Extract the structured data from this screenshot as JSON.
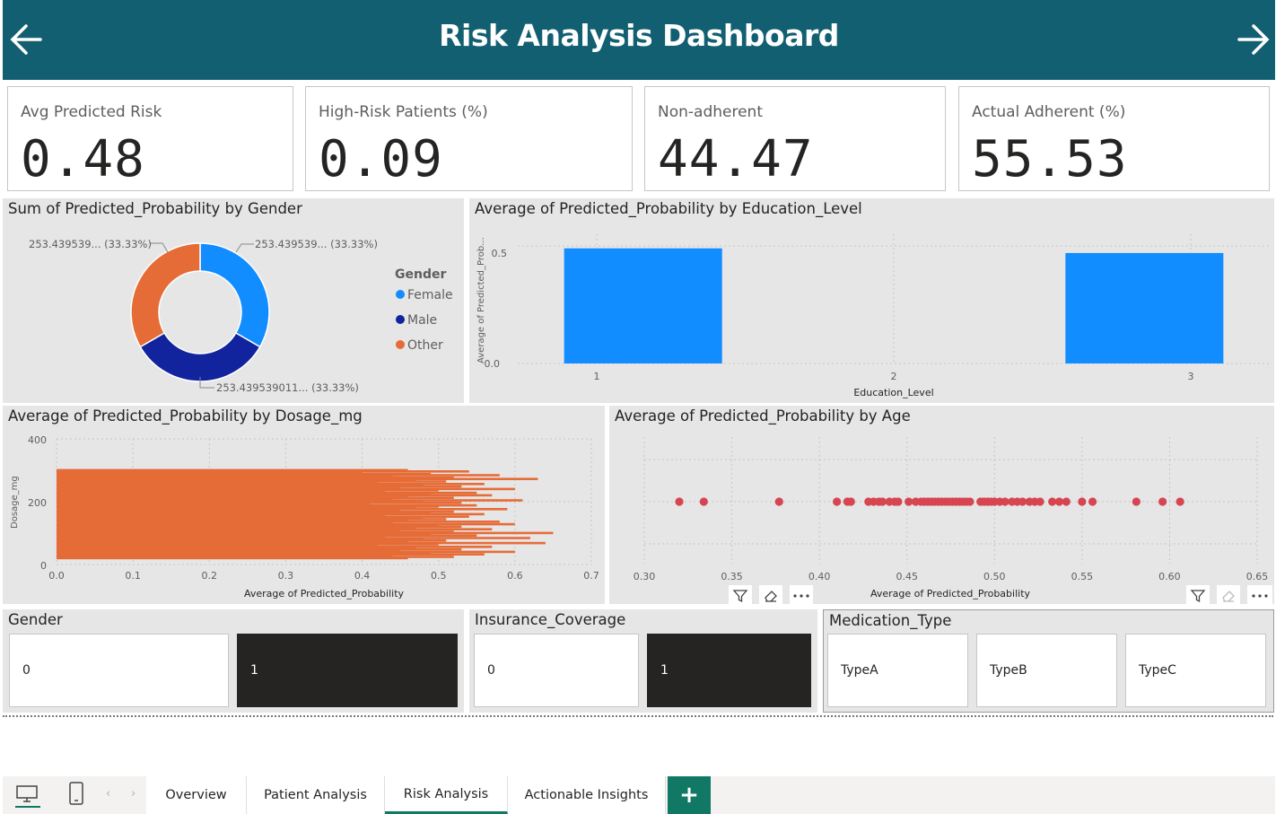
{
  "header": {
    "title": "Risk Analysis Dashboard"
  },
  "kpis": [
    {
      "label": "Avg Predicted Risk",
      "value": "0.48"
    },
    {
      "label": "High-Risk Patients (%)",
      "value": "0.09"
    },
    {
      "label": "Non-adherent",
      "value": "44.47"
    },
    {
      "label": "Actual Adherent (%)",
      "value": "55.53"
    }
  ],
  "donut": {
    "title": "Sum of Predicted_Probability by Gender",
    "labels": [
      "253.439539... (33.33%)",
      "253.439539... (33.33%)",
      "253.439539011... (33.33%)"
    ],
    "legend_title": "Gender",
    "legend": [
      {
        "name": "Female",
        "color": "#118dff"
      },
      {
        "name": "Male",
        "color": "#12239e"
      },
      {
        "name": "Other",
        "color": "#e66c37"
      }
    ]
  },
  "edu_chart": {
    "title": "Average of Predicted_Probability by Education_Level",
    "ylabel": "Average of Predicted_Prob...",
    "xlabel": "Education_Level",
    "yticks": [
      "0.0",
      "0.5"
    ],
    "xticks": [
      "1",
      "2",
      "3"
    ]
  },
  "dosage_chart": {
    "title": "Average of Predicted_Probability by Dosage_mg",
    "ylabel": "Dosage_mg",
    "xlabel": "Average of Predicted_Probability",
    "yticks": [
      "0",
      "200",
      "400"
    ],
    "xticks": [
      "0.0",
      "0.1",
      "0.2",
      "0.3",
      "0.4",
      "0.5",
      "0.6",
      "0.7"
    ]
  },
  "age_chart": {
    "title": "Average of Predicted_Probability by Age",
    "xlabel": "Average of Predicted_Probability",
    "xticks": [
      "0.30",
      "0.35",
      "0.40",
      "0.45",
      "0.50",
      "0.55",
      "0.60",
      "0.65"
    ]
  },
  "chart_data": [
    {
      "type": "pie",
      "title": "Sum of Predicted_Probability by Gender",
      "categories": [
        "Female",
        "Male",
        "Other"
      ],
      "values": [
        253.439539,
        253.439539,
        253.439539
      ]
    },
    {
      "type": "bar",
      "title": "Average of Predicted_Probability by Education_Level",
      "xlabel": "Education_Level",
      "ylabel": "Average of Predicted_Prob...",
      "categories": [
        "1",
        "2",
        "3"
      ],
      "values": [
        0.49,
        0.0,
        0.47
      ],
      "ylim": [
        0,
        0.55
      ]
    },
    {
      "type": "bar",
      "orientation": "horizontal",
      "title": "Average of Predicted_Probability by Dosage_mg",
      "xlabel": "Average of Predicted_Probability",
      "ylabel": "Dosage_mg",
      "xlim": [
        0,
        0.7
      ],
      "ylim": [
        0,
        400
      ],
      "y": [
        300,
        296,
        292,
        288,
        284,
        280,
        276,
        272,
        268,
        264,
        260,
        256,
        252,
        248,
        244,
        240,
        236,
        232,
        228,
        224,
        220,
        216,
        212,
        208,
        204,
        200,
        196,
        192,
        188,
        184,
        180,
        176,
        172,
        168,
        164,
        160,
        156,
        152,
        148,
        144,
        140,
        136,
        132,
        128,
        124,
        120,
        116,
        112,
        108,
        104,
        100,
        96,
        92,
        88,
        84,
        80,
        76,
        72,
        68,
        64,
        60,
        56,
        52,
        48,
        44,
        40,
        36,
        32,
        28,
        24,
        20
      ],
      "values": [
        0.46,
        0.54,
        0.4,
        0.49,
        0.58,
        0.44,
        0.52,
        0.63,
        0.47,
        0.51,
        0.42,
        0.56,
        0.48,
        0.53,
        0.45,
        0.6,
        0.5,
        0.43,
        0.55,
        0.49,
        0.57,
        0.46,
        0.52,
        0.44,
        0.61,
        0.48,
        0.53,
        0.41,
        0.55,
        0.5,
        0.47,
        0.59,
        0.45,
        0.52,
        0.49,
        0.56,
        0.43,
        0.54,
        0.48,
        0.51,
        0.46,
        0.58,
        0.44,
        0.6,
        0.5,
        0.53,
        0.47,
        0.57,
        0.45,
        0.52,
        0.65,
        0.49,
        0.55,
        0.43,
        0.62,
        0.48,
        0.51,
        0.46,
        0.64,
        0.5,
        0.42,
        0.57,
        0.47,
        0.53,
        0.45,
        0.6,
        0.49,
        0.56,
        0.44,
        0.52,
        0.46
      ]
    },
    {
      "type": "scatter",
      "title": "Average of Predicted_Probability by Age",
      "xlabel": "Average of Predicted_Probability",
      "xlim": [
        0.3,
        0.65
      ],
      "x": [
        0.32,
        0.334,
        0.377,
        0.41,
        0.416,
        0.418,
        0.428,
        0.431,
        0.434,
        0.436,
        0.44,
        0.443,
        0.445,
        0.451,
        0.455,
        0.458,
        0.46,
        0.462,
        0.464,
        0.466,
        0.468,
        0.47,
        0.472,
        0.474,
        0.476,
        0.478,
        0.48,
        0.482,
        0.484,
        0.486,
        0.492,
        0.494,
        0.496,
        0.498,
        0.5,
        0.503,
        0.506,
        0.51,
        0.513,
        0.516,
        0.52,
        0.523,
        0.526,
        0.533,
        0.537,
        0.541,
        0.55,
        0.556,
        0.581,
        0.596,
        0.606
      ],
      "y": [
        200,
        200,
        200,
        200,
        200,
        200,
        200,
        200,
        200,
        200,
        200,
        200,
        200,
        200,
        200,
        200,
        200,
        200,
        200,
        200,
        200,
        200,
        200,
        200,
        200,
        200,
        200,
        200,
        200,
        200,
        200,
        200,
        200,
        200,
        200,
        200,
        200,
        200,
        200,
        200,
        200,
        200,
        200,
        200,
        200,
        200,
        200,
        200,
        200,
        200,
        200
      ]
    }
  ],
  "slicers": {
    "gender": {
      "title": "Gender",
      "options": [
        "0",
        "1"
      ]
    },
    "insurance": {
      "title": "Insurance_Coverage",
      "options": [
        "0",
        "1"
      ]
    },
    "medication": {
      "title": "Medication_Type",
      "options": [
        "TypeA",
        "TypeB",
        "TypeC"
      ]
    }
  },
  "tabs": [
    "Overview",
    "Patient Analysis",
    "Risk Analysis",
    "Actionable Insights"
  ],
  "active_tab": "Risk Analysis",
  "add_tab_label": "+"
}
